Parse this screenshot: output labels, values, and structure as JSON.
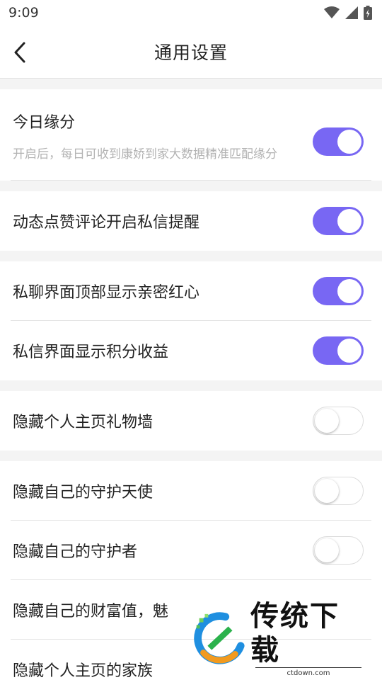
{
  "status_bar": {
    "time": "9:09"
  },
  "header": {
    "title": "通用设置"
  },
  "settings": {
    "daily_match": {
      "label": "今日缘分",
      "description": "开启后，每日可收到康娇到家大数据精准匹配缘分",
      "enabled": true
    },
    "dynamic_like_reminder": {
      "label": "动态点赞评论开启私信提醒",
      "enabled": true
    },
    "chat_intimacy_heart": {
      "label": "私聊界面顶部显示亲密红心",
      "enabled": true
    },
    "dm_points_earnings": {
      "label": "私信界面显示积分收益",
      "enabled": true
    },
    "hide_gift_wall": {
      "label": "隐藏个人主页礼物墙",
      "enabled": false
    },
    "hide_guardian_angel": {
      "label": "隐藏自己的守护天使",
      "enabled": false
    },
    "hide_guardian": {
      "label": "隐藏自己的守护者",
      "enabled": false
    },
    "hide_wealth_charm": {
      "label": "隐藏自己的财富值，魅"
    },
    "hide_family": {
      "label": "隐藏个人主页的家族"
    }
  },
  "watermark": {
    "title": "传统下载",
    "subtitle": "ctdown.com"
  },
  "colors": {
    "toggle_on": "#7867f3",
    "background": "#f4f4f4"
  }
}
